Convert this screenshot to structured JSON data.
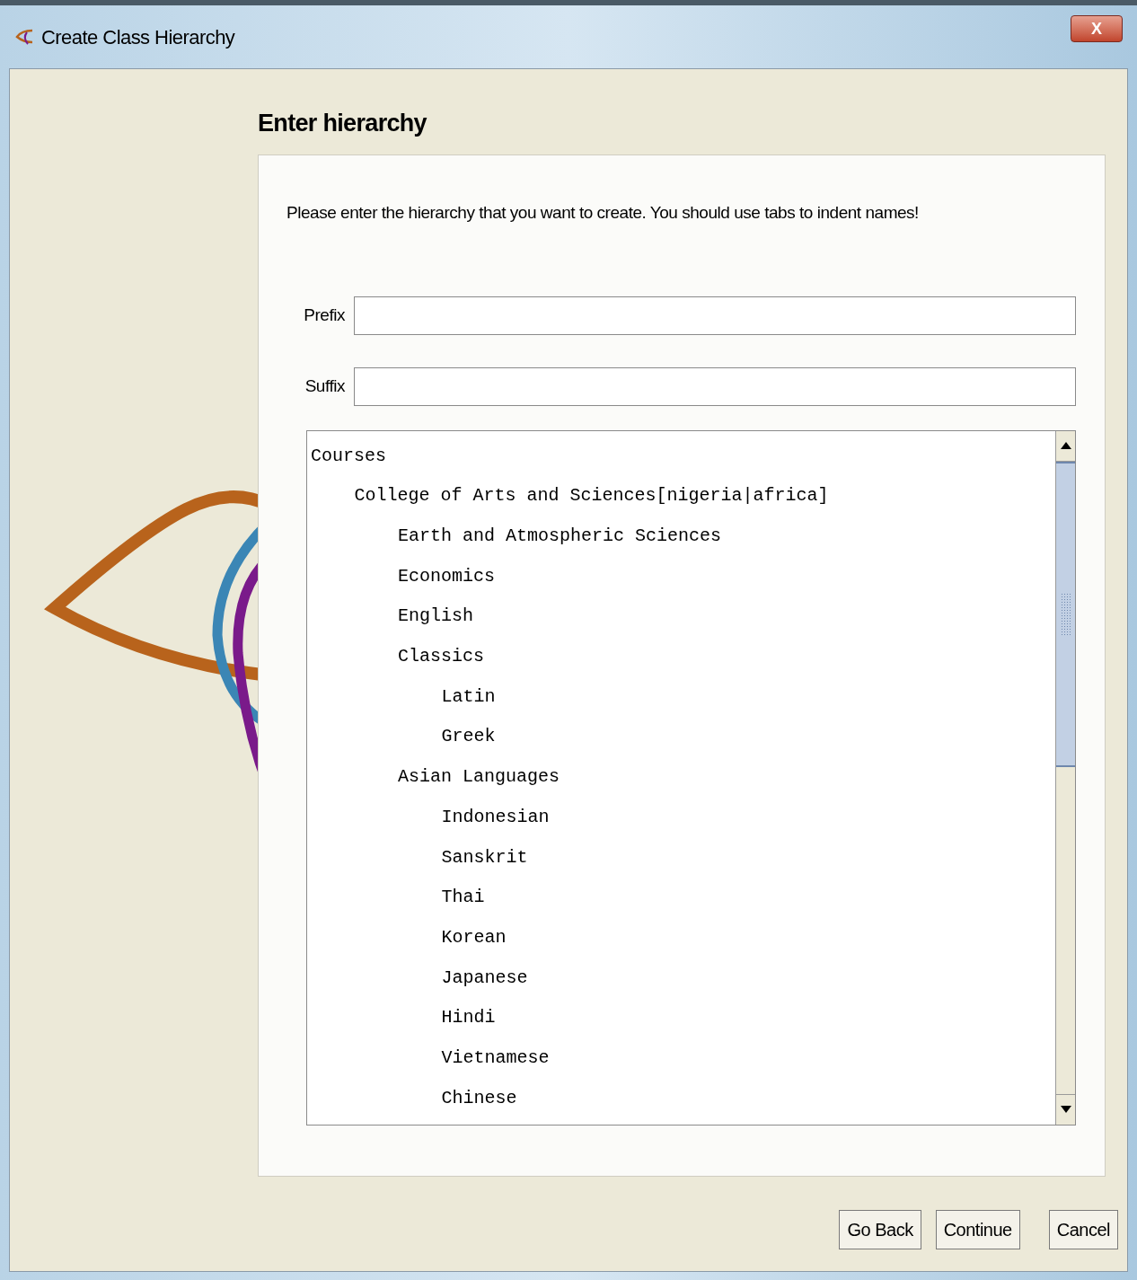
{
  "window": {
    "title": "Create Class Hierarchy",
    "close_label": "X"
  },
  "heading": "Enter hierarchy",
  "instruction": "Please enter the hierarchy that you want to create.  You should use tabs to indent names!",
  "fields": [
    {
      "label": "Prefix"
    },
    {
      "label": "Suffix"
    }
  ],
  "hierarchy": [
    {
      "name": "Courses",
      "children": [
        {
          "name": "College of Arts and Sciences[nigeria|africa]",
          "children": [
            {
              "name": "Earth and Atmospheric Sciences"
            },
            {
              "name": "Economics"
            },
            {
              "name": "English"
            },
            {
              "name": "Classics",
              "children": [
                {
                  "name": "Latin"
                },
                {
                  "name": "Greek"
                }
              ]
            },
            {
              "name": "Asian Languages",
              "children": [
                {
                  "name": "Indonesian"
                },
                {
                  "name": "Sanskrit"
                },
                {
                  "name": "Thai"
                },
                {
                  "name": "Korean"
                },
                {
                  "name": "Japanese"
                },
                {
                  "name": "Hindi"
                },
                {
                  "name": "Vietnamese"
                },
                {
                  "name": "Chinese"
                }
              ]
            }
          ]
        }
      ]
    }
  ],
  "buttons": [
    "Go Back",
    "Continue",
    "Cancel"
  ]
}
